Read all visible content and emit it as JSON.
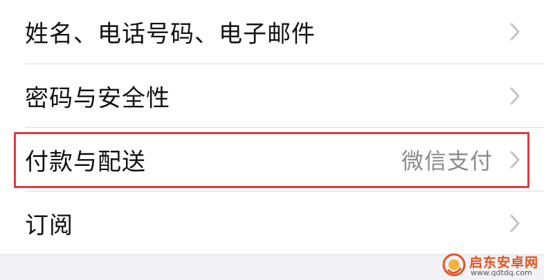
{
  "settings_list": {
    "items": [
      {
        "label": "姓名、电话号码、电子邮件",
        "value": ""
      },
      {
        "label": "密码与安全性",
        "value": ""
      },
      {
        "label": "付款与配送",
        "value": "微信支付"
      },
      {
        "label": "订阅",
        "value": ""
      }
    ]
  },
  "watermark": {
    "title": "启东安卓网",
    "url": "www.qdtdq.com"
  },
  "colors": {
    "highlight": "#e03a3f",
    "label": "#111111",
    "value": "#8a8a8e",
    "chevron": "#c4c4c7",
    "separator": "#dcdce0",
    "watermark": "#e0541f"
  },
  "icons": {
    "chevron": "chevron-right-icon",
    "watermark_logo": "logo-icon"
  }
}
